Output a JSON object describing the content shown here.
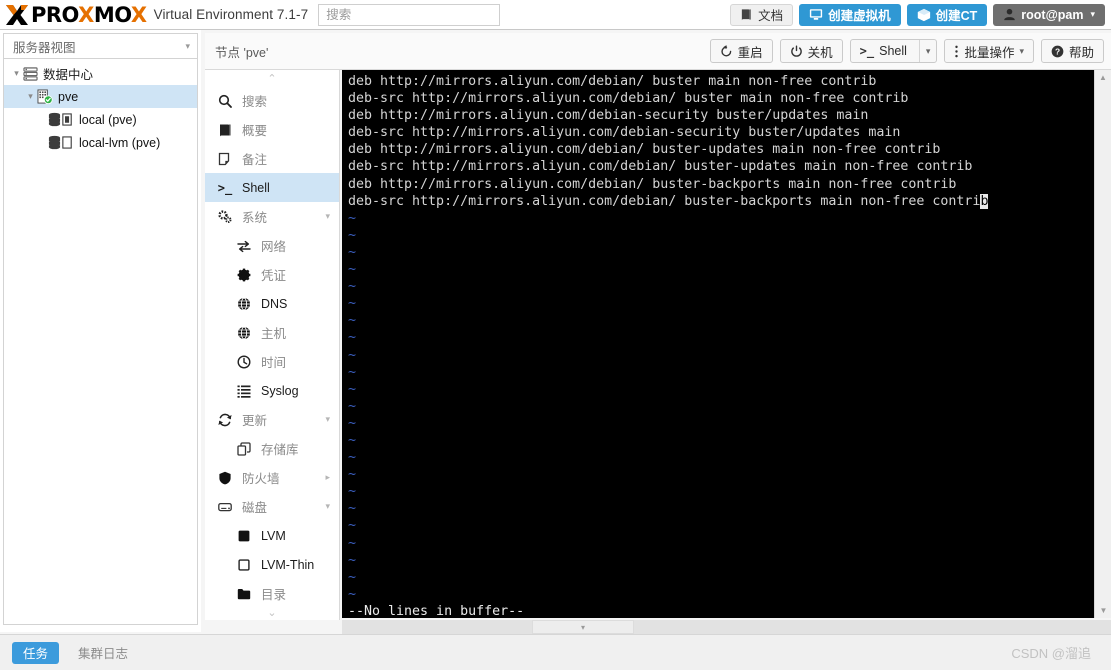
{
  "header": {
    "brand_pro": "PRO",
    "brand_x1": "X",
    "brand_mo": "MO",
    "brand_x2": "X",
    "product": "Virtual Environment 7.1-7",
    "search_placeholder": "搜索",
    "buttons": {
      "docs": "文档",
      "create_vm": "创建虚拟机",
      "create_ct": "创建CT",
      "user": "root@pam"
    }
  },
  "sidebar": {
    "view_selector": "服务器视图",
    "tree": [
      {
        "label": "数据中心",
        "level": 0,
        "icon": "datacenter-icon",
        "selected": false,
        "twisty": "▾"
      },
      {
        "label": "pve",
        "level": 1,
        "icon": "node-ok-icon",
        "selected": true,
        "twisty": "▾"
      },
      {
        "label": "local (pve)",
        "level": 2,
        "icon": "storage-icon",
        "selected": false,
        "twisty": ""
      },
      {
        "label": "local-lvm (pve)",
        "level": 2,
        "icon": "storage-empty-icon",
        "selected": false,
        "twisty": ""
      }
    ]
  },
  "menu": {
    "items": [
      {
        "label": "搜索",
        "icon": "search-icon",
        "level": 0,
        "selected": false,
        "arrow": ""
      },
      {
        "label": "概要",
        "icon": "summary-icon",
        "level": 0,
        "selected": false,
        "arrow": ""
      },
      {
        "label": "备注",
        "icon": "notes-icon",
        "level": 0,
        "selected": false,
        "arrow": ""
      },
      {
        "label": "Shell",
        "icon": "shell-icon",
        "level": 0,
        "selected": true,
        "arrow": ""
      },
      {
        "label": "系统",
        "icon": "system-icon",
        "level": 0,
        "selected": false,
        "arrow": "▾"
      },
      {
        "label": "网络",
        "icon": "network-icon",
        "level": 1,
        "selected": false,
        "arrow": ""
      },
      {
        "label": "凭证",
        "icon": "certificate-icon",
        "level": 1,
        "selected": false,
        "arrow": ""
      },
      {
        "label": "DNS",
        "icon": "dns-icon",
        "level": 1,
        "selected": false,
        "arrow": ""
      },
      {
        "label": "主机",
        "icon": "hosts-icon",
        "level": 1,
        "selected": false,
        "arrow": ""
      },
      {
        "label": "时间",
        "icon": "time-icon",
        "level": 1,
        "selected": false,
        "arrow": ""
      },
      {
        "label": "Syslog",
        "icon": "syslog-icon",
        "level": 1,
        "selected": false,
        "arrow": ""
      },
      {
        "label": "更新",
        "icon": "update-icon",
        "level": 0,
        "selected": false,
        "arrow": "▾"
      },
      {
        "label": "存储库",
        "icon": "repository-icon",
        "level": 1,
        "selected": false,
        "arrow": ""
      },
      {
        "label": "防火墙",
        "icon": "firewall-icon",
        "level": 0,
        "selected": false,
        "arrow": "▸"
      },
      {
        "label": "磁盘",
        "icon": "disk-icon",
        "level": 0,
        "selected": false,
        "arrow": "▾"
      },
      {
        "label": "LVM",
        "icon": "lvm-icon",
        "level": 1,
        "selected": false,
        "arrow": ""
      },
      {
        "label": "LVM-Thin",
        "icon": "lvmthin-icon",
        "level": 1,
        "selected": false,
        "arrow": ""
      },
      {
        "label": "目录",
        "icon": "directory-icon",
        "level": 1,
        "selected": false,
        "arrow": ""
      }
    ]
  },
  "node_toolbar": {
    "title": "节点 'pve'",
    "restart": "重启",
    "shutdown": "关机",
    "shell": "Shell",
    "bulk_actions": "批量操作",
    "help": "帮助"
  },
  "terminal": {
    "lines": [
      "deb http://mirrors.aliyun.com/debian/ buster main non-free contrib",
      "deb-src http://mirrors.aliyun.com/debian/ buster main non-free contrib",
      "deb http://mirrors.aliyun.com/debian-security buster/updates main",
      "deb-src http://mirrors.aliyun.com/debian-security buster/updates main",
      "deb http://mirrors.aliyun.com/debian/ buster-updates main non-free contrib",
      "deb-src http://mirrors.aliyun.com/debian/ buster-updates main non-free contrib",
      "deb http://mirrors.aliyun.com/debian/ buster-backports main non-free contrib"
    ],
    "cursor_line_prefix": "deb-src http://mirrors.aliyun.com/debian/ buster-backports main non-free contri",
    "cursor_char": "b",
    "tilde_marker": "~",
    "tilde_count": 23,
    "status_line": "--No lines in buffer--"
  },
  "statusbar": {
    "tasks_tab": "任务",
    "cluster_log_tab": "集群日志",
    "watermark": "CSDN @溜追"
  },
  "colors": {
    "brand_orange": "#E57000",
    "accent_blue": "#2f98d4",
    "selection_blue": "#cfe4f5",
    "terminal_bg": "#000000",
    "tilde_blue": "#3b5fc0"
  }
}
